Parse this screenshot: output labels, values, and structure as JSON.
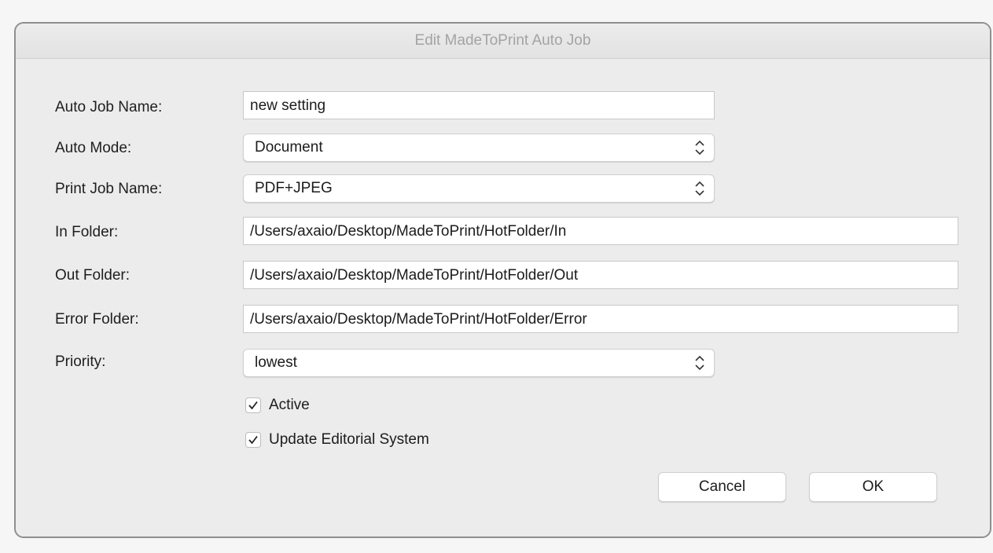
{
  "dialog": {
    "title": "Edit MadeToPrint Auto Job"
  },
  "form": {
    "auto_job_name": {
      "label": "Auto Job Name:",
      "value": "new setting"
    },
    "auto_mode": {
      "label": "Auto Mode:",
      "selected": "Document"
    },
    "print_job_name": {
      "label": "Print Job Name:",
      "selected": "PDF+JPEG"
    },
    "in_folder": {
      "label": "In Folder:",
      "value": "/Users/axaio/Desktop/MadeToPrint/HotFolder/In"
    },
    "out_folder": {
      "label": "Out Folder:",
      "value": "/Users/axaio/Desktop/MadeToPrint/HotFolder/Out"
    },
    "error_folder": {
      "label": "Error Folder:",
      "value": "/Users/axaio/Desktop/MadeToPrint/HotFolder/Error"
    },
    "priority": {
      "label": "Priority:",
      "selected": "lowest"
    },
    "active": {
      "label": "Active",
      "checked": true
    },
    "update_editorial": {
      "label": "Update Editorial System",
      "checked": true
    }
  },
  "buttons": {
    "cancel": "Cancel",
    "ok": "OK"
  },
  "icons": {
    "select_arrows": "chevron-up-down-icon",
    "checkmark": "checkmark-icon"
  },
  "colors": {
    "window_bg": "#ececec",
    "title_text": "#a3a3a3",
    "border": "#8f8f8f"
  }
}
